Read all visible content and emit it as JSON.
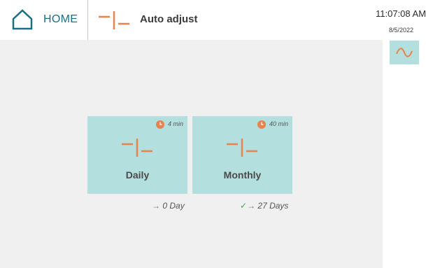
{
  "header": {
    "home_label": "HOME",
    "title": "Auto adjust",
    "time": "11:07:08 AM",
    "date": "8/5/2022"
  },
  "colors": {
    "accent": "#e8834e",
    "brand": "#1a6f86",
    "card_bg": "#b3e0df",
    "content_bg": "#f0f0f0",
    "check": "#3aa64a"
  },
  "icons": {
    "home": "home-icon",
    "title": "adjust-icon",
    "side_button": "sine-wave-icon",
    "card_clock": "clock-icon"
  },
  "cards": [
    {
      "label": "Daily",
      "duration": "4 min",
      "status_check": "",
      "status_arrow": "→",
      "status_text": "0 Day"
    },
    {
      "label": "Monthly",
      "duration": "40 min",
      "status_check": "✓",
      "status_arrow": "→",
      "status_text": "27 Days"
    }
  ]
}
